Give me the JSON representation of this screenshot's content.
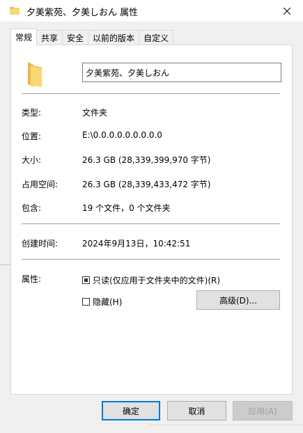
{
  "window": {
    "title": "夕美紫苑、夕美しおん 属性"
  },
  "tabs": [
    {
      "label": "常规",
      "active": true
    },
    {
      "label": "共享",
      "active": false
    },
    {
      "label": "安全",
      "active": false
    },
    {
      "label": "以前的版本",
      "active": false
    },
    {
      "label": "自定义",
      "active": false
    }
  ],
  "general": {
    "name_value": "夕美紫苑、夕美しおん",
    "type_label": "类型:",
    "type_value": "文件夹",
    "location_label": "位置:",
    "location_value": "E:\\0.0.0.0.0.0.0.0.0",
    "size_label": "大小:",
    "size_value": "26.3 GB (28,339,399,970 字节)",
    "size_on_disk_label": "占用空间:",
    "size_on_disk_value": "26.3 GB (28,339,433,472 字节)",
    "contains_label": "包含:",
    "contains_value": "19 个文件，0 个文件夹",
    "created_label": "创建时间:",
    "created_value": "2024年9月13日，10:42:51",
    "attributes_label": "属性:",
    "readonly_label": "只读(仅应用于文件夹中的文件)(R)",
    "hidden_label": "隐藏(H)",
    "advanced_label": "高级(D)..."
  },
  "footer": {
    "ok_label": "确定",
    "cancel_label": "取消",
    "apply_label": "应用(A)"
  },
  "colors": {
    "accent": "#0078d7",
    "folder": "#f8d775",
    "folder_dark": "#e8b84a"
  }
}
